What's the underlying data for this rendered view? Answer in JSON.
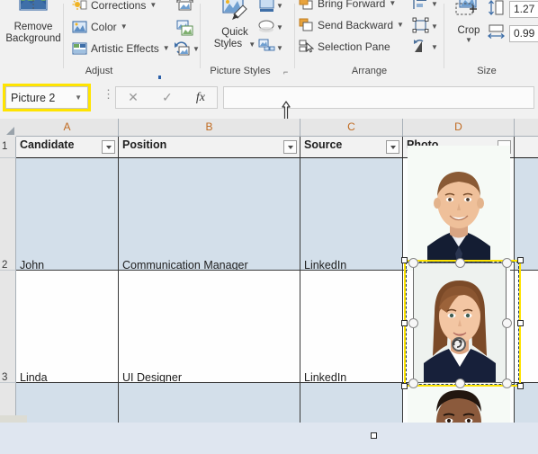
{
  "ribbon": {
    "groups": [
      {
        "name": "Adjust",
        "label": "Adjust"
      },
      {
        "name": "Picture Styles",
        "label": "Picture Styles"
      },
      {
        "name": "Arrange",
        "label": "Arrange"
      },
      {
        "name": "Size",
        "label": "Size"
      }
    ],
    "adjust": {
      "remove_background": "Remove\nBackground",
      "remove_background_line1": "Remove",
      "remove_background_line2": "Background",
      "corrections": "Corrections",
      "color": "Color",
      "artistic_effects": "Artistic Effects",
      "compress_pictures_icon": "compress-pictures-icon",
      "change_picture_icon": "change-picture-icon",
      "reset_picture_icon": "reset-picture-icon"
    },
    "picture_styles": {
      "quick_styles_line1": "Quick",
      "quick_styles_line2": "Styles",
      "picture_border_icon": "picture-border-icon",
      "picture_effects_icon": "picture-effects-icon",
      "picture_layout_icon": "picture-layout-icon",
      "dialog_launcher_icon": "dialog-launcher-icon"
    },
    "arrange": {
      "bring_forward": "Bring Forward",
      "send_backward": "Send Backward",
      "selection_pane": "Selection Pane",
      "align_icon": "align-icon",
      "group_icon": "group-icon",
      "rotate_icon": "rotate-icon"
    },
    "size": {
      "crop": "Crop",
      "height_icon": "shape-height-icon",
      "width_icon": "shape-width-icon",
      "height_value": "1.27",
      "width_value": "0.99"
    }
  },
  "formula_bar": {
    "name_box_value": "Picture 2",
    "name_box_placeholder": "Name Box",
    "cancel_icon": "cancel-icon",
    "cancel_glyph": "✕",
    "enter_icon": "check-icon",
    "enter_glyph": "✓",
    "insert_function_glyph": "fx",
    "formula_value": "",
    "formula_placeholder": "",
    "highlight_color": "#ffe400"
  },
  "grid": {
    "columns": [
      {
        "letter": "A",
        "header": "Candidate"
      },
      {
        "letter": "B",
        "header": "Position"
      },
      {
        "letter": "C",
        "header": "Source"
      },
      {
        "letter": "D",
        "header": "Photo"
      }
    ],
    "row_numbers": [
      "1",
      "2",
      "3"
    ],
    "rows": [
      {
        "num": "2",
        "candidate": "John",
        "position": "Communication Manager",
        "source": "LinkedIn",
        "photo": "photo-john"
      },
      {
        "num": "3",
        "candidate": "Linda",
        "position": "UI Designer",
        "source": "LinkedIn",
        "photo": "photo-linda"
      }
    ],
    "third_photo": "photo-third",
    "band_color": "#d3dfea",
    "header_color": "#f2f2f2",
    "column_letter_color": "#c06a20"
  },
  "selection": {
    "selected_object": "Picture 2",
    "selected_row": "3",
    "selected_column": "D",
    "handle_count": 8,
    "rotation_handle": "rotation-handle"
  }
}
